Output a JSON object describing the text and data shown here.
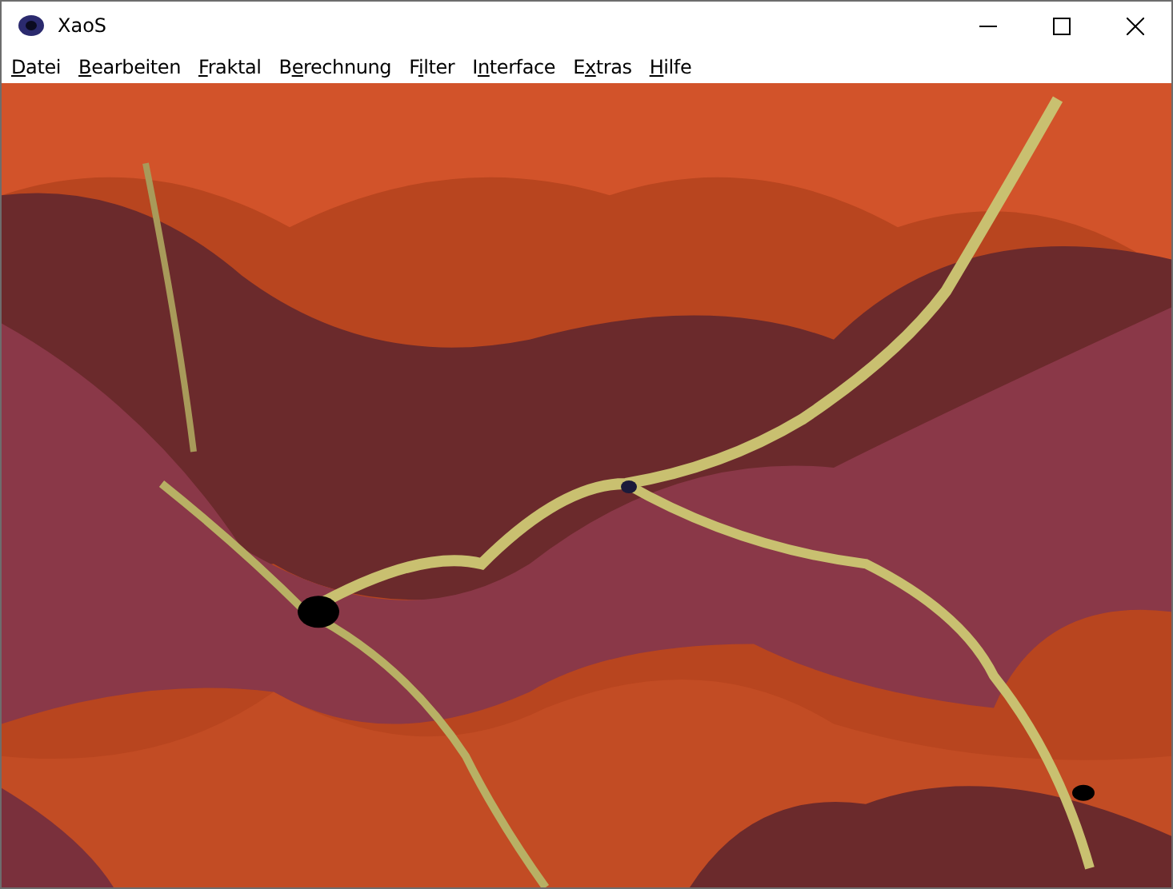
{
  "window": {
    "title": "XaoS"
  },
  "menu": [
    {
      "key": "D",
      "rest": "atei"
    },
    {
      "key": "B",
      "rest": "earbeiten"
    },
    {
      "key": "F",
      "rest": "raktal"
    },
    {
      "prefix": "B",
      "key": "e",
      "rest": "rechnung"
    },
    {
      "prefix": "F",
      "key": "i",
      "rest": "lter"
    },
    {
      "prefix": "I",
      "key": "n",
      "rest": "terface"
    },
    {
      "prefix": "E",
      "key": "x",
      "rest": "tras"
    },
    {
      "key": "H",
      "rest": "ilfe"
    }
  ]
}
